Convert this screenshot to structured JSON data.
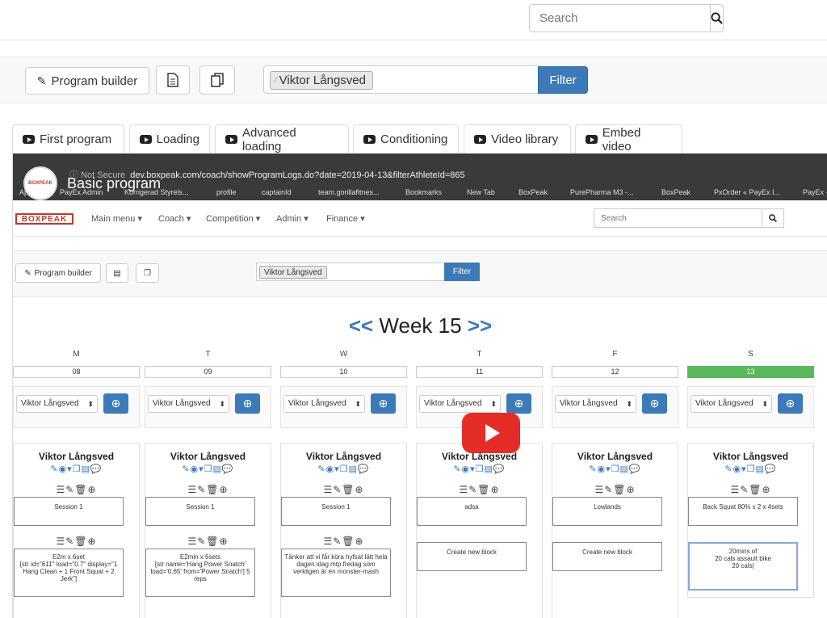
{
  "search": {
    "placeholder": "Search"
  },
  "toolbar": {
    "program_builder_label": "Program builder",
    "athlete_chip": "Viktor Långsved",
    "filter_label": "Filter"
  },
  "tabs": [
    {
      "label": "First program"
    },
    {
      "label": "Loading"
    },
    {
      "label": "Advanced loading"
    },
    {
      "label": "Conditioning"
    },
    {
      "label": "Video library"
    },
    {
      "label": "Embed video"
    }
  ],
  "video": {
    "title": "Basic program",
    "logo_text": "BOXPEAK",
    "browser": {
      "not_secure": "Not Secure",
      "url": "dev.boxpeak.com/coach/showProgramLogs.do?date=2019-04-13&filterAthleteId=865",
      "bookmarks": [
        "Ap",
        "PayEx Admin",
        "Korrigerad Styrels...",
        "profile",
        "captainId",
        "team.gorillafitnes...",
        "Bookmarks",
        "New Tab",
        "BoxPeak",
        "PurePharma M3 -...",
        "BoxPeak",
        "PxOrder « PayEx I...",
        "PayEx -"
      ]
    },
    "app": {
      "brand": "BOXPEAK",
      "nav": [
        "Main menu ▾",
        "Coach ▾",
        "Competition ▾",
        "Admin ▾",
        "Finance ▾"
      ],
      "search_placeholder": "Search",
      "program_builder_label": "Program builder",
      "athlete_chip": "Viktor Långsved",
      "filter_label": "Filter",
      "week_label": "Week 15",
      "prev": "<<",
      "next": ">>",
      "days": [
        {
          "letter": "M",
          "num": "08",
          "athlete": "Viktor Långsved",
          "select": "Viktor Långsved",
          "block1": "Session 1",
          "block2": "E2m x 6set\n[str id=\"611\" load=\"0.7\" display=\"1 Hang Clean + 1 Front Squat + 2 Jerk\"]"
        },
        {
          "letter": "T",
          "num": "09",
          "athlete": "Viktor Långsved",
          "select": "Viktor Långsved",
          "block1": "Session 1",
          "block2": "E2min x 6sets\n[str name='Hang Power Snatch' load='0.65' from='Power Snatch'] 5 reps"
        },
        {
          "letter": "W",
          "num": "10",
          "athlete": "Viktor Långsved",
          "select": "Viktor Långsved",
          "block1": "Session 1",
          "block2": "Tänker att vi får köra hyfsat lätt hela dagen idag mtp fredag som verkligen är en monster-mash"
        },
        {
          "letter": "T",
          "num": "11",
          "athlete": "Viktor Långsved",
          "select": "Viktor Långsved",
          "block1": "adsa",
          "block2": "Create new block"
        },
        {
          "letter": "F",
          "num": "12",
          "athlete": "Viktor Långsved",
          "select": "Viktor Långsved",
          "block1": "Lowlands",
          "block2": "Create new block"
        },
        {
          "letter": "S",
          "num": "13",
          "athlete": "Viktor Långsved",
          "select": "Viktor Långsved",
          "block1": "Back Squat 80% x 2 x 4sets",
          "block2": "20mins of\n20 cals assault bike\n20 cals|"
        }
      ]
    }
  }
}
